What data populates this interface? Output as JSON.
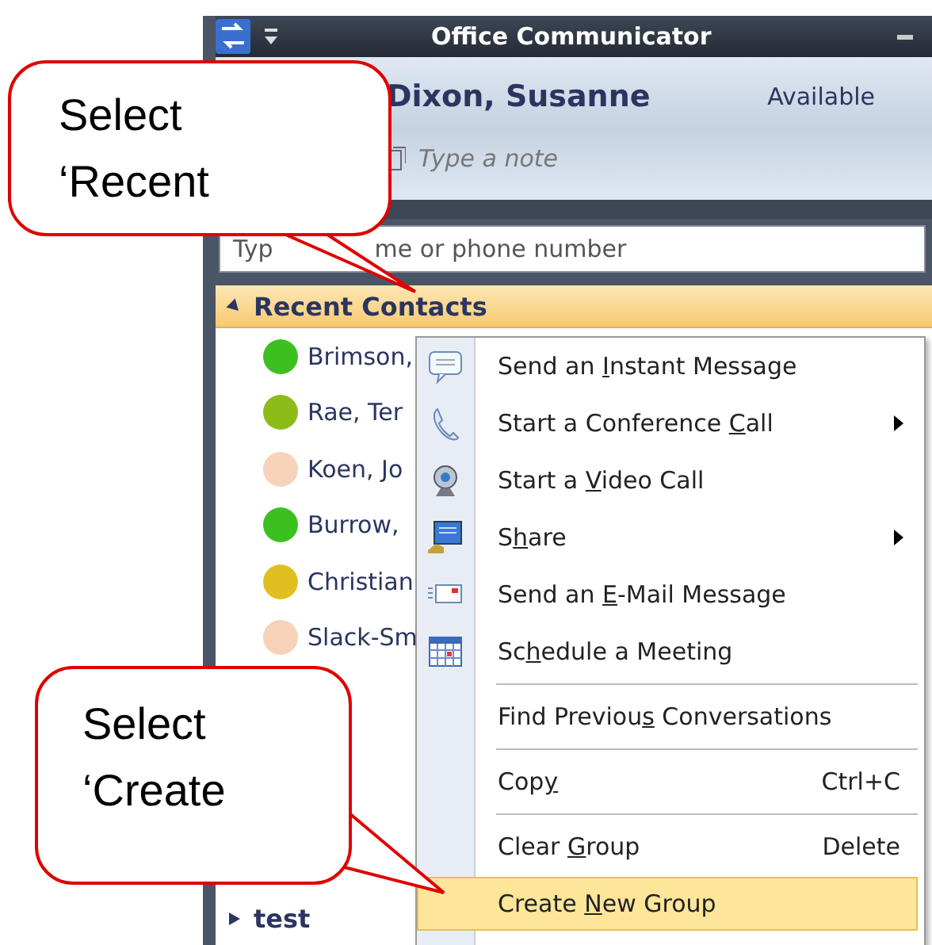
{
  "window": {
    "title": "Office Communicator"
  },
  "user": {
    "name": "Dixon, Susanne",
    "status": "Available",
    "note_placeholder": "Type a note"
  },
  "search": {
    "placeholder_start": "Typ",
    "placeholder_end": "me or phone number"
  },
  "groups": [
    {
      "name": "Recent Contacts",
      "expanded": true,
      "contacts": [
        {
          "name": "Brimson,",
          "color": "#3cc020"
        },
        {
          "name": "Rae, Ter",
          "color": "#8cbc18"
        },
        {
          "name": "Koen, Jo",
          "color": "#f6d2b8"
        },
        {
          "name": "Burrow,",
          "color": "#3cc020"
        },
        {
          "name": "Christian",
          "color": "#e0c020"
        },
        {
          "name": "Slack-Sm",
          "color": "#f6d2b8"
        }
      ]
    },
    {
      "name": "test",
      "expanded": false
    }
  ],
  "context_menu": {
    "items": [
      {
        "kind": "item",
        "before": "Send an ",
        "key": "I",
        "after": "nstant Message",
        "submenu": false,
        "selected": false
      },
      {
        "kind": "item",
        "before": "Start a Conference ",
        "key": "C",
        "after": "all",
        "submenu": true,
        "selected": false
      },
      {
        "kind": "item",
        "before": "Start a ",
        "key": "V",
        "after": "ideo Call",
        "submenu": false,
        "selected": false
      },
      {
        "kind": "item",
        "before": "S",
        "key": "h",
        "after": "are",
        "submenu": true,
        "selected": false
      },
      {
        "kind": "item",
        "before": "Send an ",
        "key": "E",
        "after": "-Mail Message",
        "submenu": false,
        "selected": false
      },
      {
        "kind": "item",
        "before": "Sc",
        "key": "h",
        "after": "edule a Meeting",
        "submenu": false,
        "selected": false
      },
      {
        "kind": "separator"
      },
      {
        "kind": "item",
        "before": "Find Previou",
        "key": "s",
        "after": " Conversations",
        "submenu": false,
        "selected": false
      },
      {
        "kind": "separator"
      },
      {
        "kind": "item",
        "before": "Cop",
        "key": "y",
        "shortcut": "Ctrl+C",
        "submenu": false,
        "selected": false
      },
      {
        "kind": "separator"
      },
      {
        "kind": "item",
        "before": "Clear ",
        "key": "G",
        "after": "roup",
        "shortcut": "Delete",
        "submenu": false,
        "selected": false
      },
      {
        "kind": "item",
        "before": "Create ",
        "key": "N",
        "after": "ew Group",
        "submenu": false,
        "selected": true
      }
    ]
  },
  "callouts": [
    {
      "lines": [
        "Select",
        "‘Recent"
      ]
    },
    {
      "lines": [
        "Select",
        "‘Create"
      ]
    }
  ]
}
